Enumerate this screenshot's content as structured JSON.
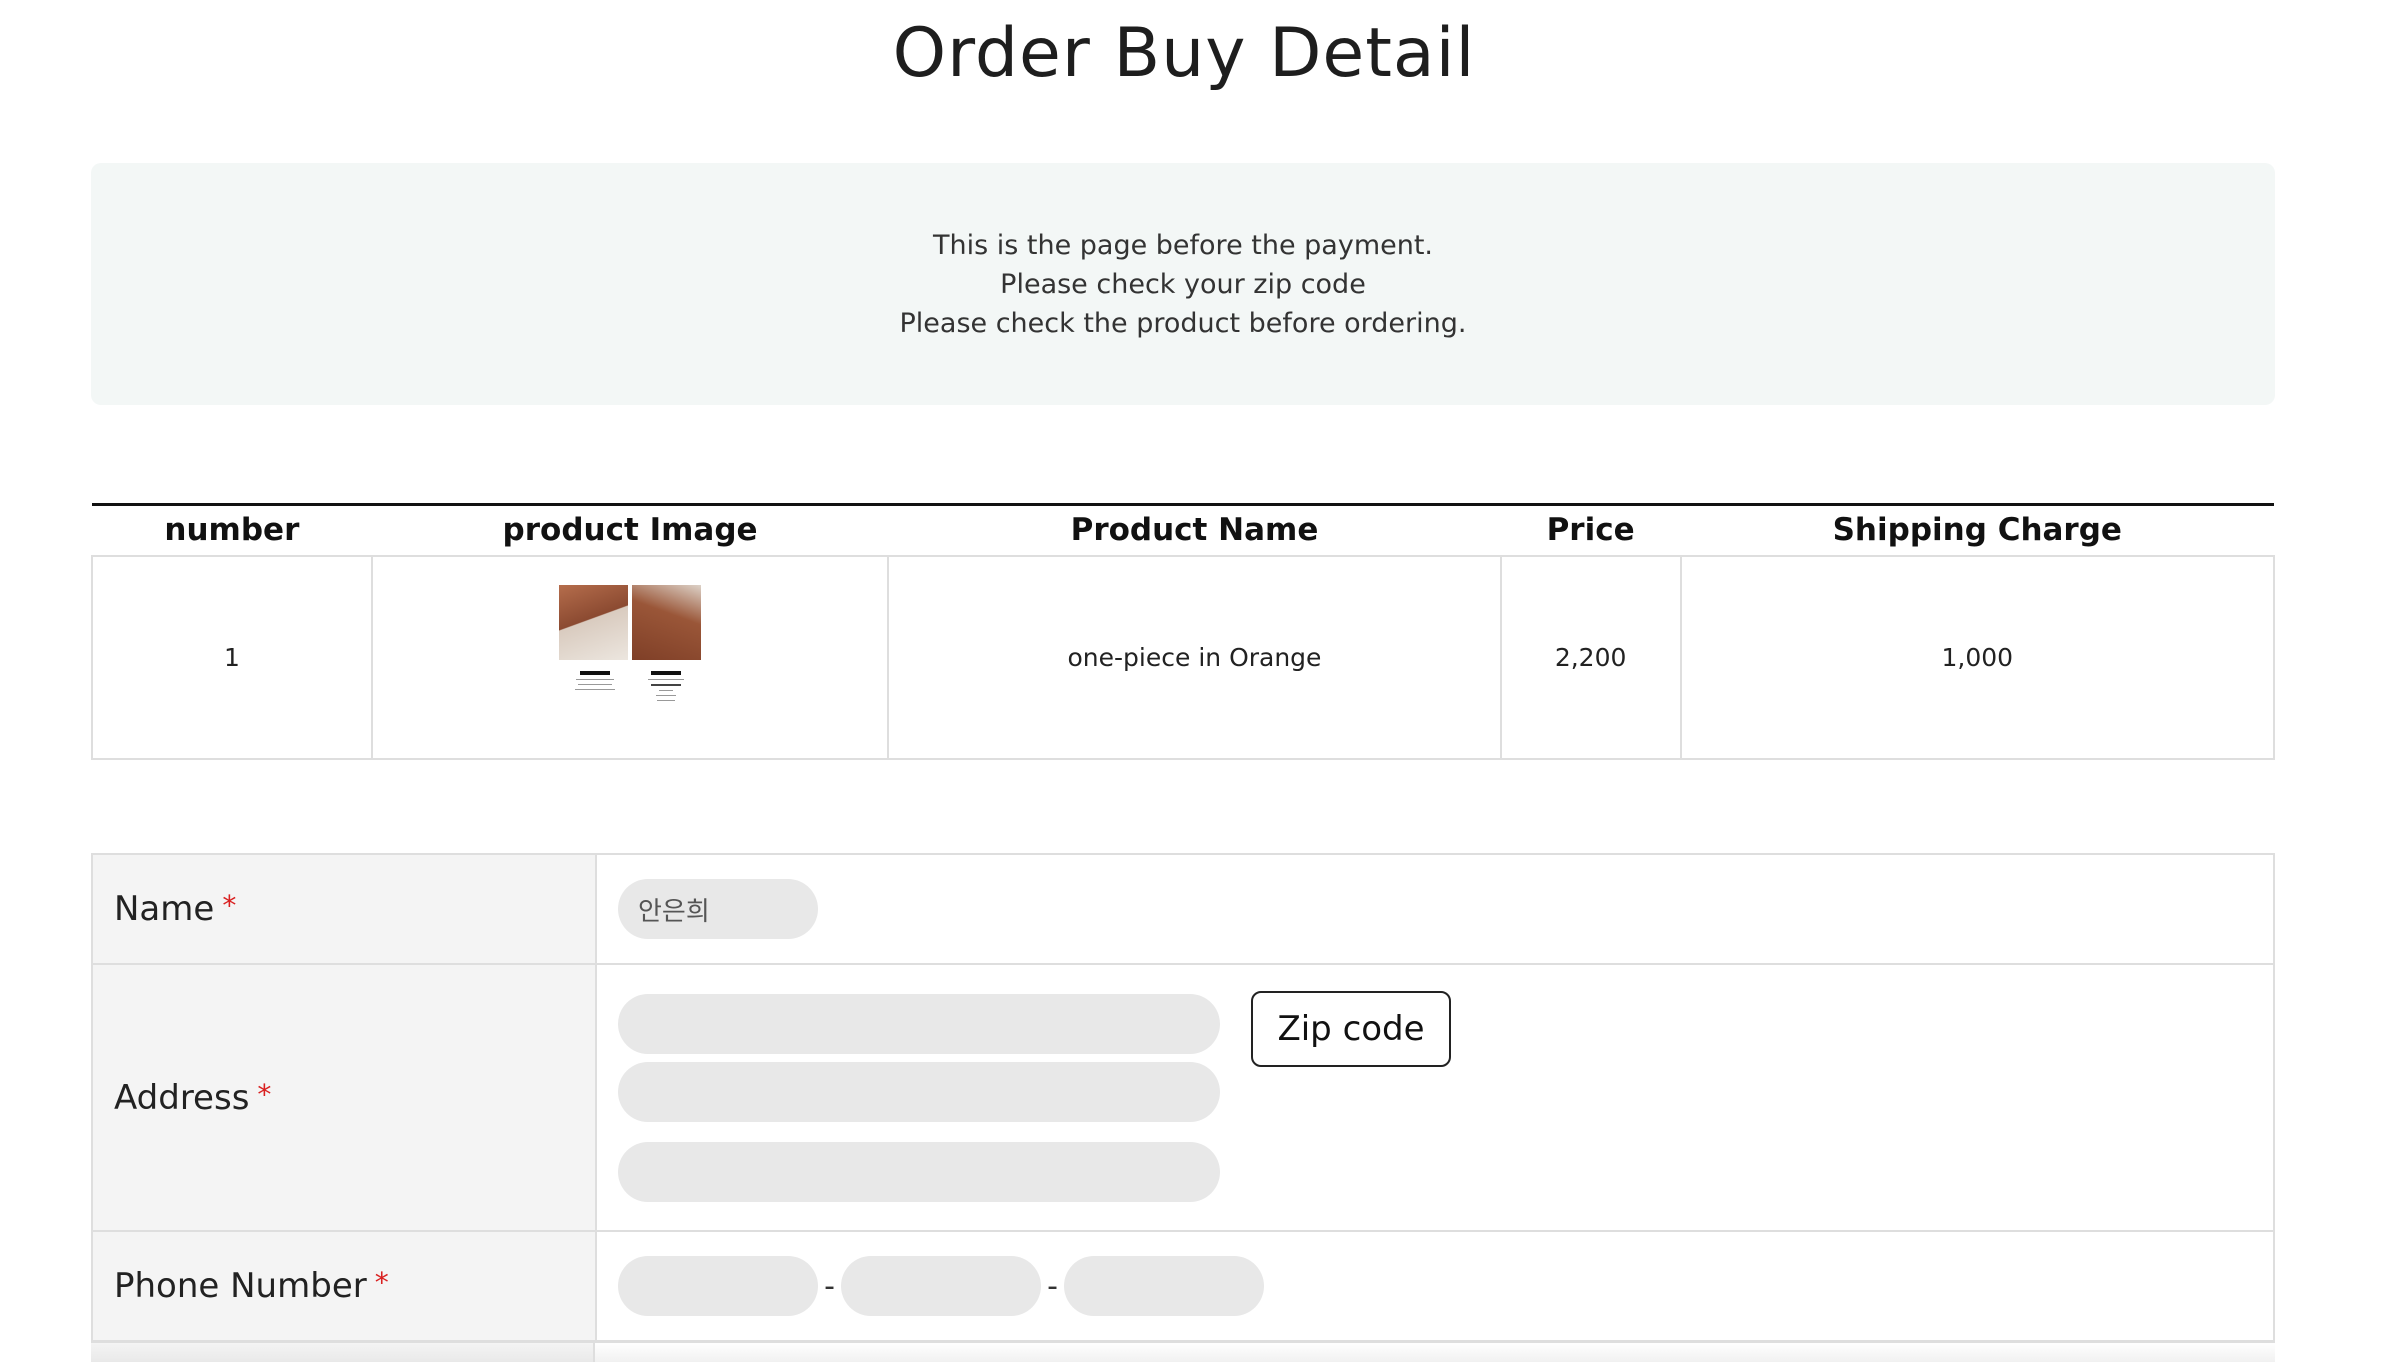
{
  "page": {
    "title": "Order Buy Detail"
  },
  "notice": {
    "lines": [
      "This is the page before the payment.",
      "Please check your zip code",
      "Please check the product before ordering."
    ]
  },
  "product_table": {
    "headers": [
      "number",
      "product Image",
      "Product Name",
      "Price",
      "Shipping Charge"
    ],
    "rows": [
      {
        "number": "1",
        "image": "product-thumbnail",
        "name": "one-piece in Orange",
        "price": "2,200",
        "shipping": "1,000"
      }
    ]
  },
  "form": {
    "name": {
      "label": "Name",
      "required_mark": "*",
      "value": "안은희"
    },
    "address": {
      "label": "Address",
      "required_mark": "*",
      "zip_button": "Zip code",
      "line1": "",
      "line2": "",
      "line3": ""
    },
    "phone": {
      "label": "Phone Number",
      "required_mark": "*",
      "separator": "-",
      "part1": "",
      "part2": "",
      "part3": ""
    }
  }
}
